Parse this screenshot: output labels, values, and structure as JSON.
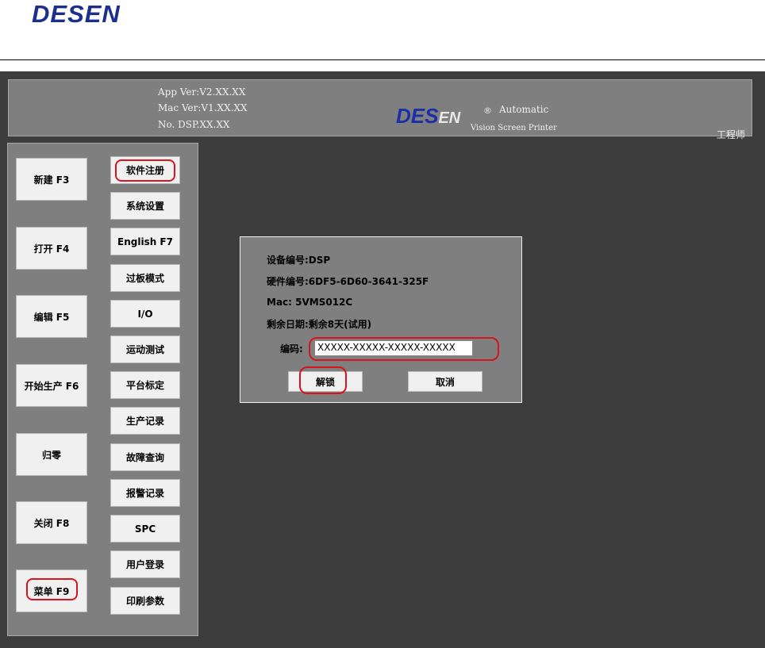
{
  "doc": {
    "logo_text": "DESEN"
  },
  "header": {
    "app_ver": "App Ver:V2.XX.XX",
    "mac_ver": "Mac Ver:V1.XX.XX",
    "no": "No. DSP.XX.XX",
    "logo_main": "DES",
    "logo_sub": "EN",
    "registered": "®",
    "automatic": "Automatic",
    "subtitle": "Vision Screen Printer",
    "user_role": "工程师"
  },
  "left_buttons": [
    "新建 F3",
    "打开 F4",
    "编辑 F5",
    "开始生产 F6",
    "归零",
    "关闭 F8",
    "菜单 F9"
  ],
  "menu_buttons": [
    "软件注册",
    "系统设置",
    "English F7",
    "过板模式",
    "I/O",
    "运动测试",
    "平台标定",
    "生产记录",
    "故障查询",
    "报警记录",
    "SPC",
    "用户登录",
    "印刷参数"
  ],
  "dialog": {
    "device_no": "设备编号:DSP",
    "hardware_no": "硬件编号:6DF5-6D60-3641-325F",
    "mac": "Mac: 5VMS012C",
    "remaining": "剩余日期:剩余8天(试用)",
    "code_label": "编码:",
    "code_value": "XXXXX-XXXXX-XXXXX-XXXXX",
    "unlock_label": "解锁",
    "cancel_label": "取消"
  },
  "colors": {
    "highlight": "#d8141e",
    "panel": "#7f7f7f",
    "background": "#3d3d3d"
  }
}
